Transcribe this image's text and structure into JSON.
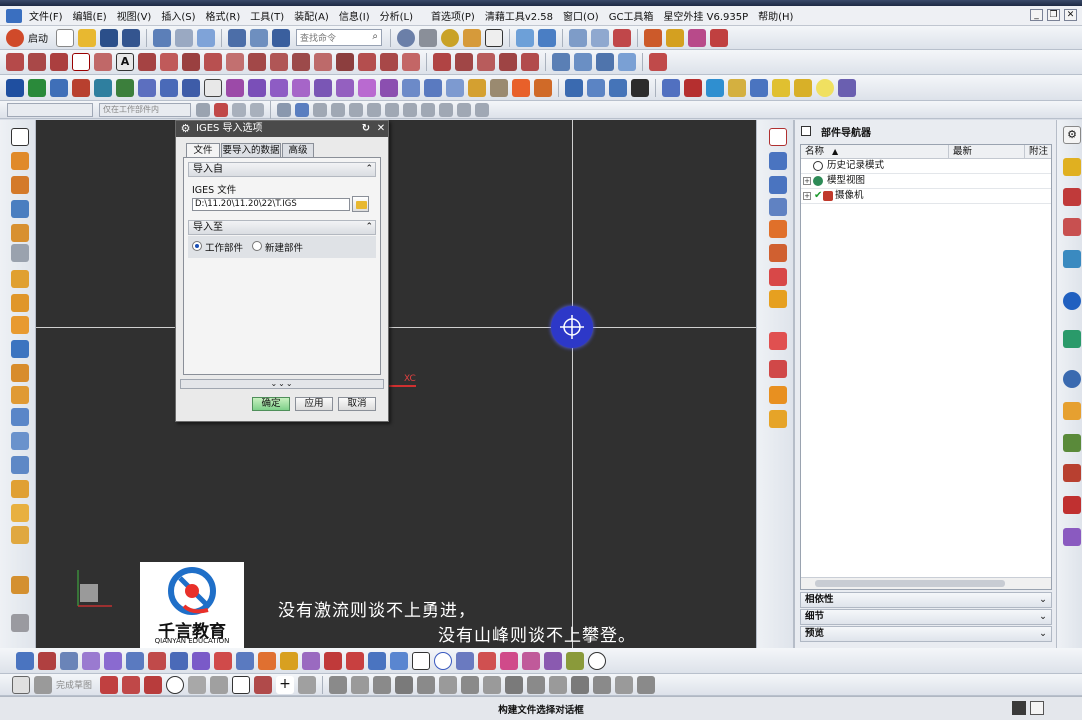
{
  "menu": [
    "文件(F)",
    "编辑(E)",
    "视图(V)",
    "插入(S)",
    "格式(R)",
    "工具(T)",
    "装配(A)",
    "信息(I)",
    "分析(L)",
    "首选项(P)",
    "清藉工具v2.58",
    "窗口(O)",
    "GC工具箱",
    "星空外挂 V6.935P",
    "帮助(H)"
  ],
  "toolbar": {
    "start_label": "启动",
    "search_placeholder": "查找命令"
  },
  "selection_bar": {
    "filter_combo": "",
    "scope_combo": "仅在工作部件内"
  },
  "dialog": {
    "title": "IGES 导入选项",
    "tabs": [
      "文件",
      "要导入的数据",
      "高级"
    ],
    "import_from": {
      "label": "导入自",
      "file_label": "IGES 文件",
      "file_path": "D:\\11.20\\11.20\\22\\T.IGS"
    },
    "import_to": {
      "label": "导入至",
      "options": [
        "工作部件",
        "新建部件"
      ],
      "selected": "工作部件"
    },
    "more_label": "⌄⌄⌄",
    "buttons": {
      "ok": "确定",
      "apply": "应用",
      "cancel": "取消"
    }
  },
  "viewport": {
    "xc_label": "XC"
  },
  "navigator": {
    "title": "部件导航器",
    "columns": [
      "名称",
      "最新",
      "附注"
    ],
    "rows": [
      {
        "label": "历史记录模式",
        "expand": "",
        "icon_color": "#3a3a3a"
      },
      {
        "label": "模型视图",
        "expand": "+",
        "icon_color": "#2e8b57"
      },
      {
        "label": "摄像机",
        "expand": "+",
        "icon_color": "#c0392b"
      }
    ],
    "panels": [
      "相依性",
      "细节",
      "预览"
    ]
  },
  "logo": {
    "cn": "千言教育",
    "en": "QIANYAN EDUCATION"
  },
  "subtitles": [
    "没有激流则谈不上勇进，",
    "没有山峰则谈不上攀登。"
  ],
  "bottom_toolbar": {
    "sketch_label": "完成草图"
  },
  "status": {
    "message": "构建文件选择对话框"
  },
  "colors": {
    "viewport_bg": "#303030",
    "navigator_bg": "#e9ecf1",
    "accent": "#2d38c8",
    "ok_green": "#7ed08a"
  }
}
